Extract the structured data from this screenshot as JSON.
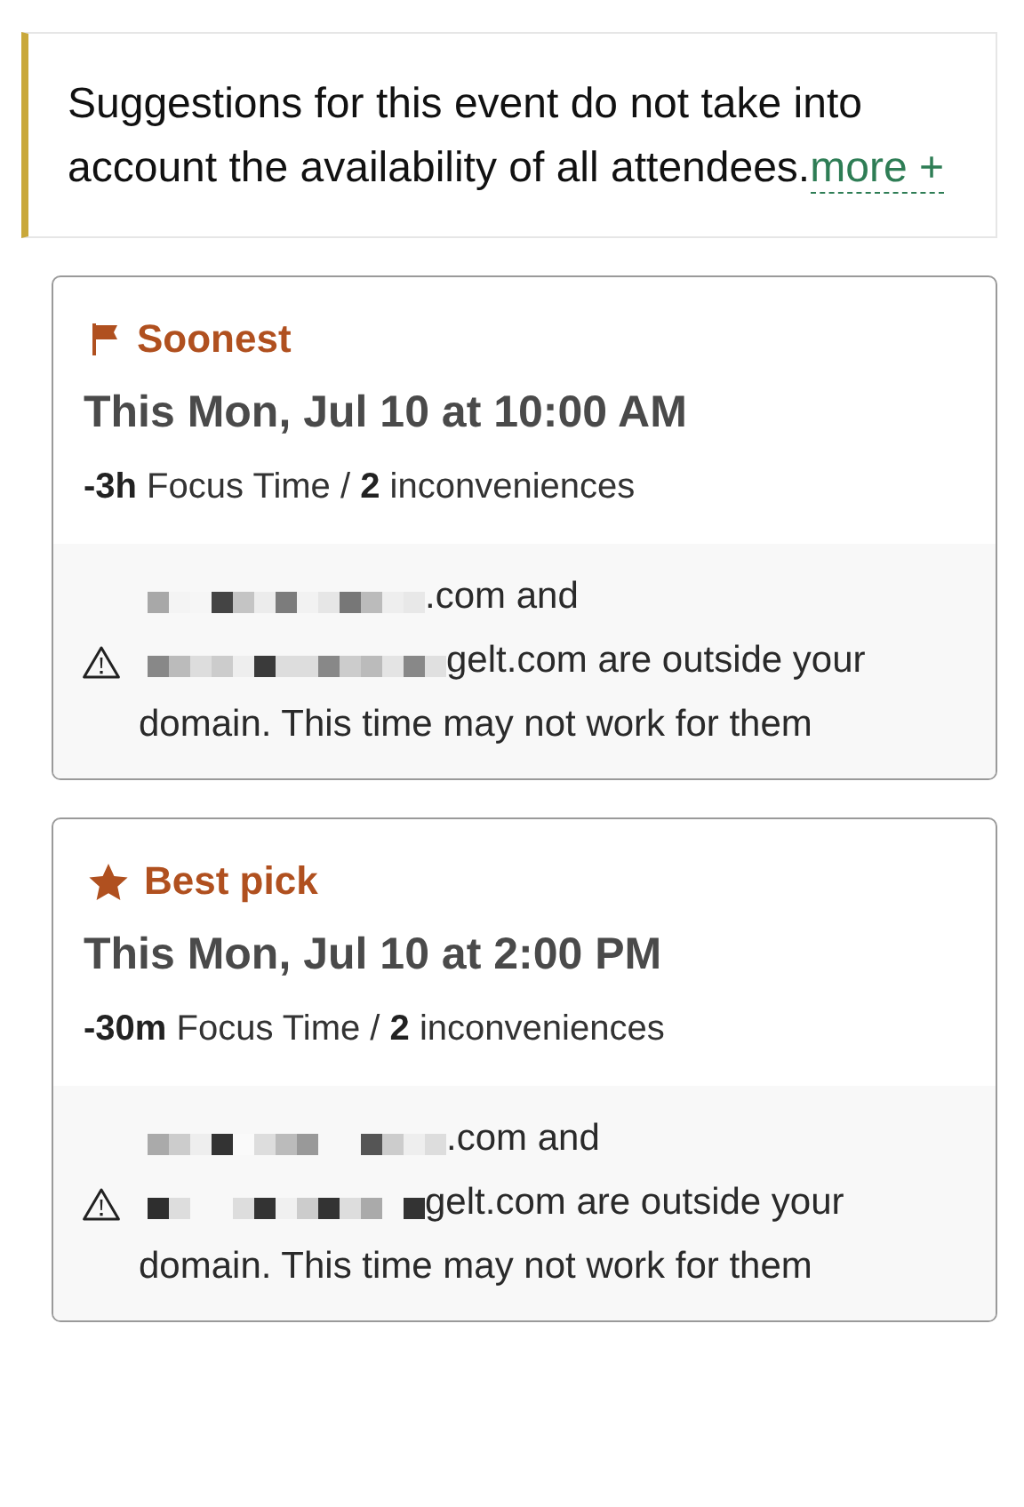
{
  "notice": {
    "text": "Suggestions for this event do not take into account the availability of all attendees.",
    "link": "more +"
  },
  "suggestions": [
    {
      "kind": "soonest",
      "label": "Soonest",
      "time": "This Mon, Jul 10 at 10:00 AM",
      "meta": "**-3h** Focus Time / **2** inconveniences",
      "warning": {
        "line_1": ".com and",
        "line_2": "gelt.com are outside your",
        "line_3": "domain. This time may not work for them"
      }
    },
    {
      "kind": "best",
      "label": "Best pick",
      "time": "This Mon, Jul 10 at 2:00 PM",
      "meta": "**-30m** Focus Time / **2** inconveniences",
      "warning": {
        "line_1": ".com and",
        "line_2": "gelt.com are outside your",
        "line_3": "domain. This time may not work for them"
      }
    }
  ]
}
